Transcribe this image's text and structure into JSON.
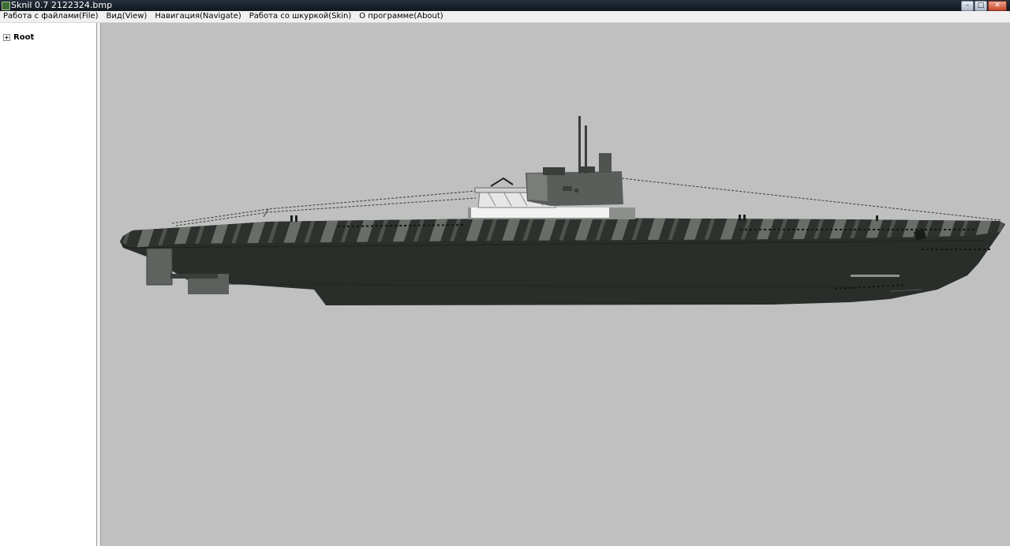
{
  "window": {
    "title": "Sknil 0.7   2122324.bmp",
    "buttons": [
      "minimize-icon",
      "maximize-icon",
      "close-icon"
    ]
  },
  "menu": {
    "items": [
      "Работа с файлами(File)",
      "Вид(View)",
      "Навигация(Navigate)",
      "Работа со шкуркой(Skin)",
      "О программе(About)"
    ]
  },
  "tree": {
    "root_label": "Root",
    "expander_icon": "plus-box-icon"
  },
  "viewport": {
    "background": "#c0c0c0",
    "content": "submarine-render",
    "hull_color": "#2a2e2a",
    "camo_color": "#7b807b"
  }
}
